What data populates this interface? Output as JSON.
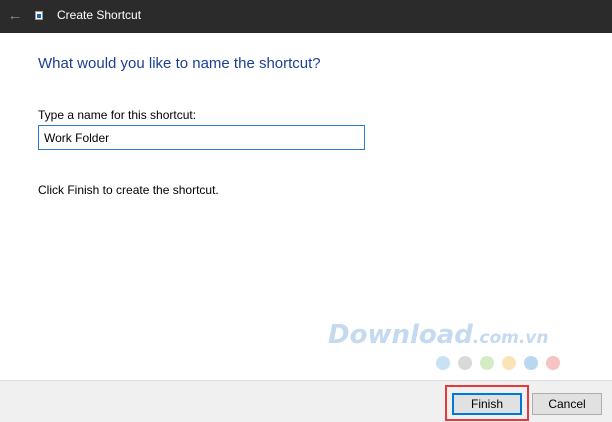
{
  "window": {
    "title": "Create Shortcut",
    "back_icon": "arrow-left-icon",
    "app_icon": "shortcut-icon"
  },
  "wizard": {
    "heading": "What would you like to name the shortcut?",
    "field_label": "Type a name for this shortcut:",
    "field_value": "Work Folder",
    "hint": "Click Finish to create the shortcut."
  },
  "watermark": {
    "brand": "Download",
    "domain": ".com.vn",
    "dot_colors": [
      "#c7e2f5",
      "#d9d9d9",
      "#d4ecc2",
      "#fbe3b8",
      "#b9d7f0",
      "#f6c3c3"
    ]
  },
  "buttons": {
    "finish_label": "Finish",
    "cancel_label": "Cancel"
  },
  "colors": {
    "titlebar": "#2b2b2b",
    "heading": "#1b3f94",
    "highlight": "#e13b3b"
  }
}
